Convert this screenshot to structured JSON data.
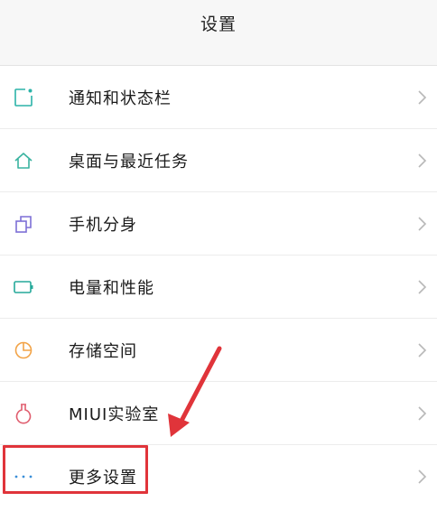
{
  "header": {
    "title": "设置"
  },
  "items": [
    {
      "label": "通知和状态栏",
      "icon": "notification-icon",
      "color": "#2bb3a8"
    },
    {
      "label": "桌面与最近任务",
      "icon": "home-icon",
      "color": "#39b3a0"
    },
    {
      "label": "手机分身",
      "icon": "clone-icon",
      "color": "#7d6fd6"
    },
    {
      "label": "电量和性能",
      "icon": "battery-icon",
      "color": "#25a99a"
    },
    {
      "label": "存储空间",
      "icon": "storage-pie-icon",
      "color": "#f2a347"
    },
    {
      "label": "MIUI实验室",
      "icon": "flask-icon",
      "color": "#e05d6e"
    },
    {
      "label": "更多设置",
      "icon": "more-dots-icon",
      "color": "#3b8fd8"
    }
  ],
  "annotation": {
    "highlight_color": "#e0343a"
  }
}
